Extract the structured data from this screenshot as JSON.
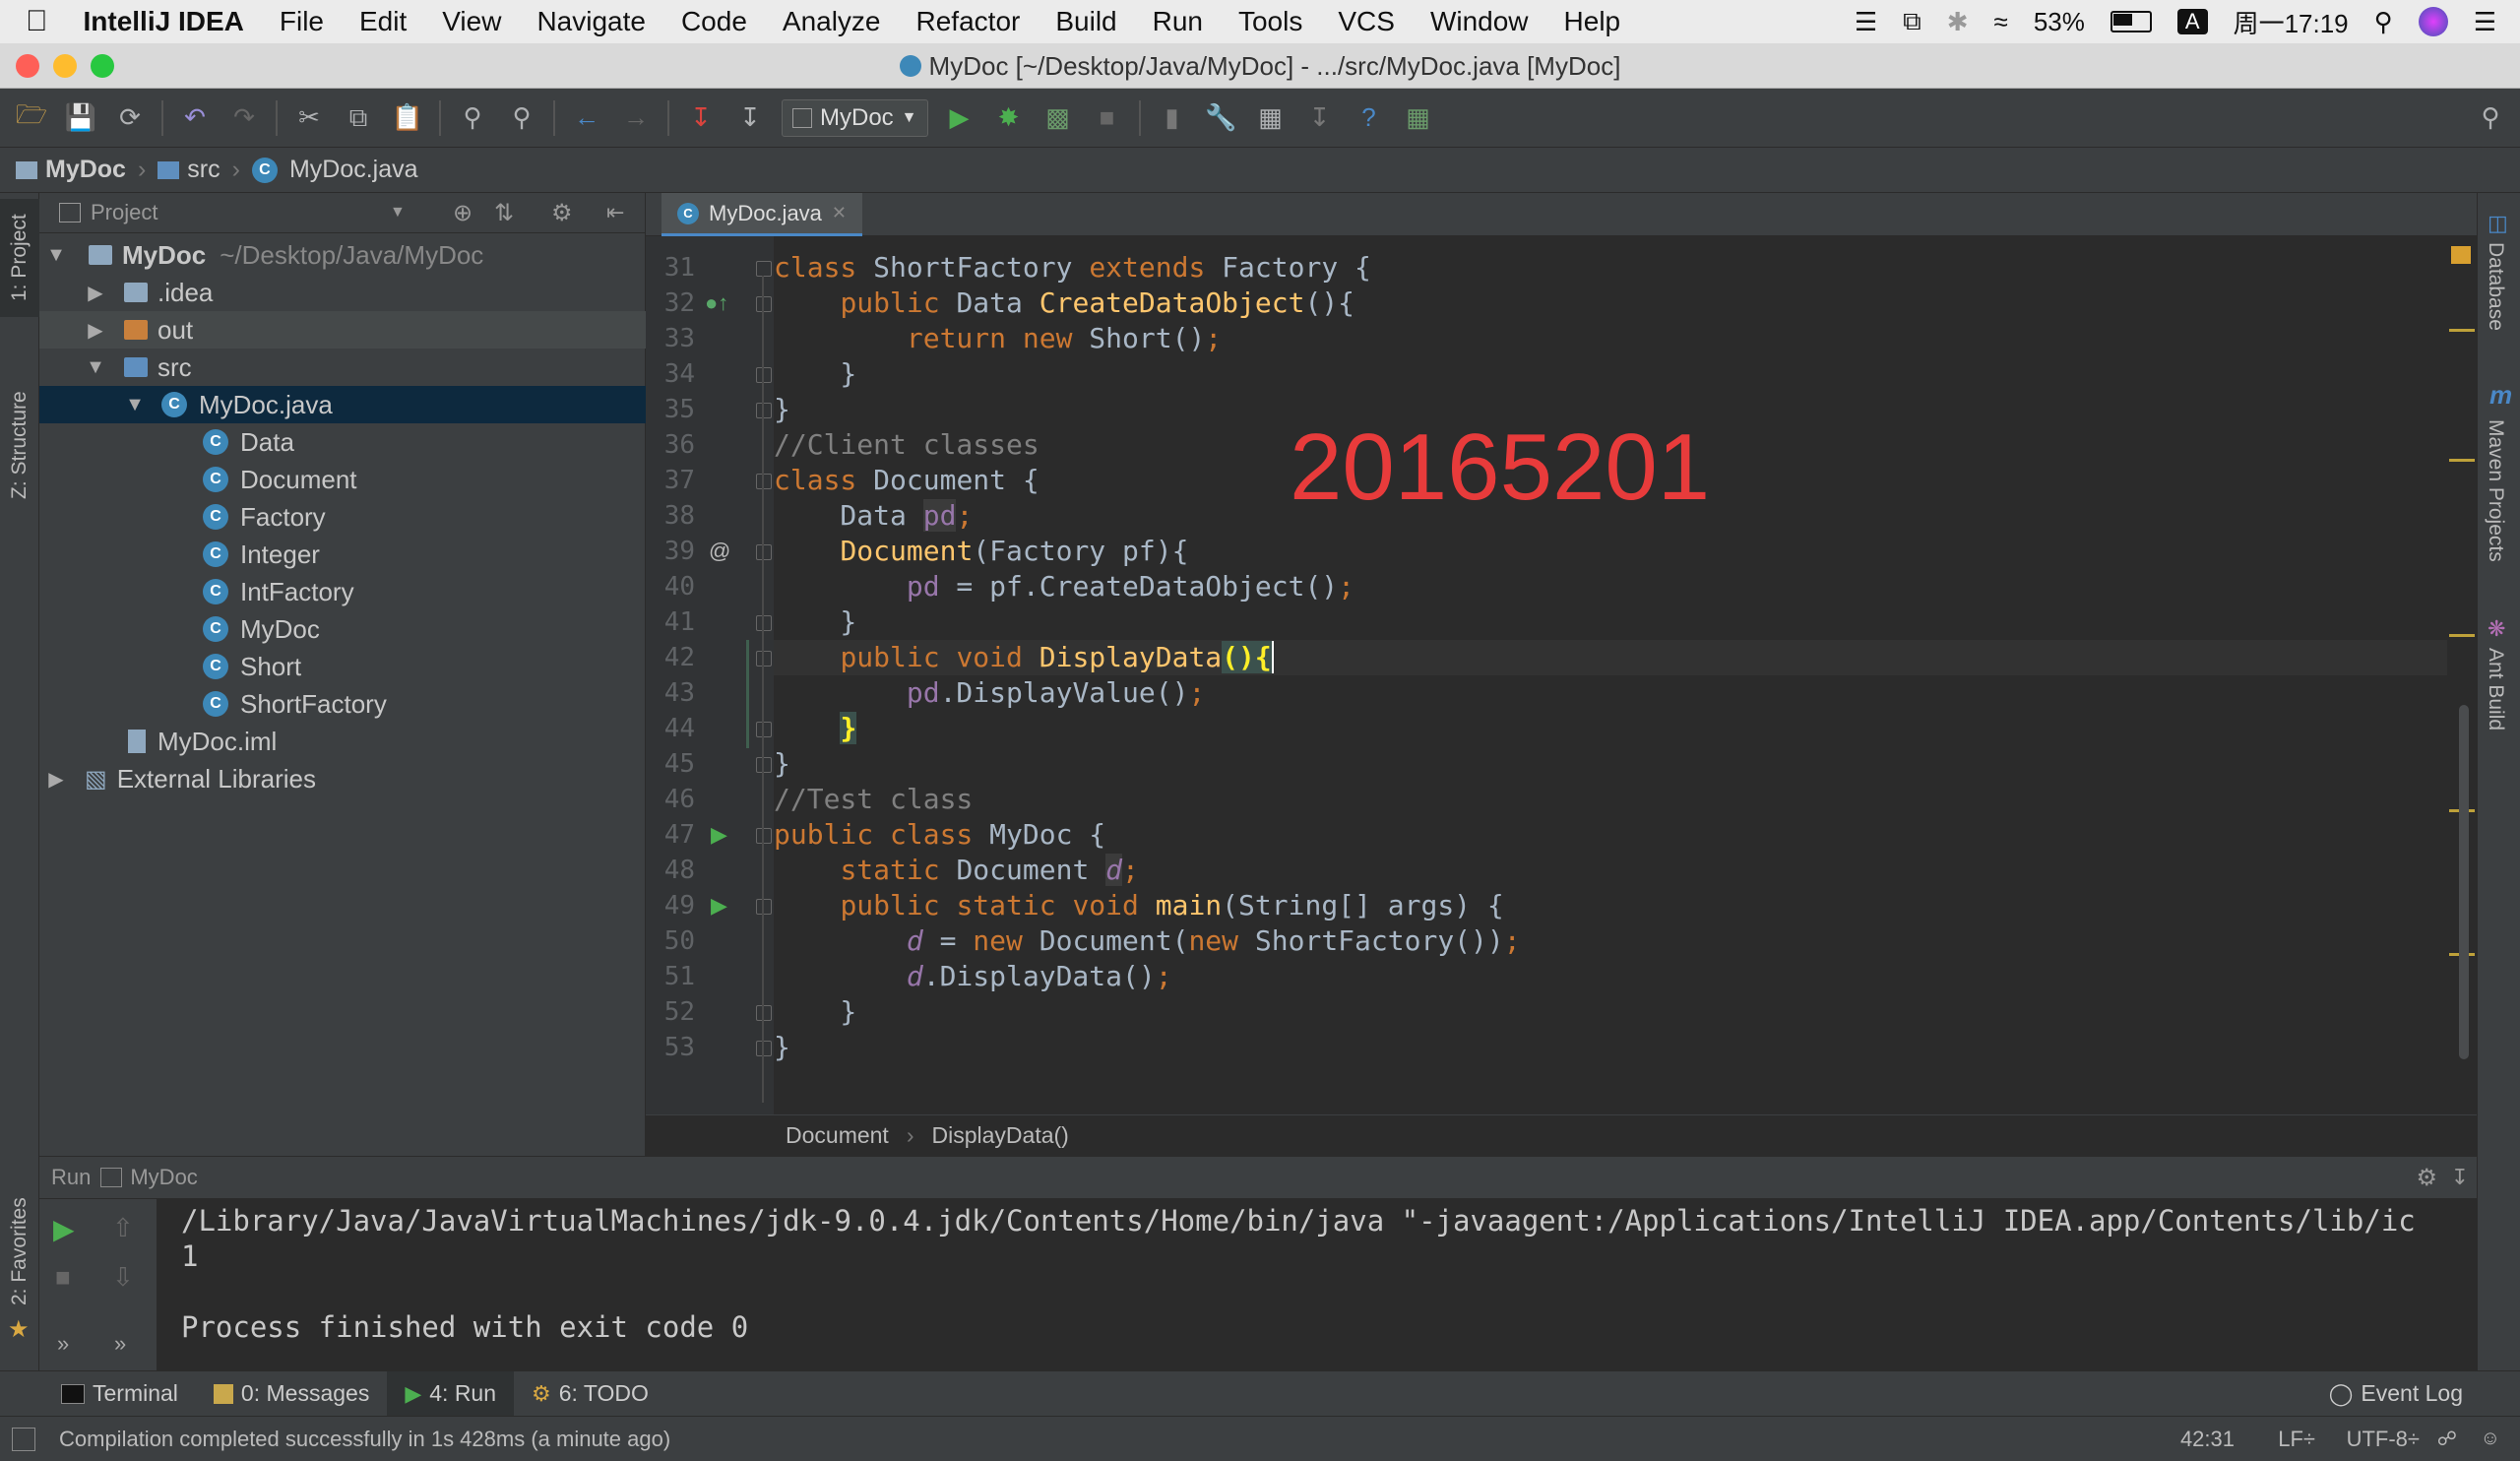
{
  "menubar": {
    "apple": "",
    "app": "IntelliJ IDEA",
    "items": [
      "File",
      "Edit",
      "View",
      "Navigate",
      "Code",
      "Analyze",
      "Refactor",
      "Build",
      "Run",
      "Tools",
      "VCS",
      "Window",
      "Help"
    ],
    "battery": "53%",
    "input": "A",
    "clock": "周一17:19"
  },
  "window": {
    "title": "MyDoc [~/Desktop/Java/MyDoc] - .../src/MyDoc.java [MyDoc]"
  },
  "toolbar": {
    "run_config": "MyDoc"
  },
  "navbar": {
    "crumbs": [
      "MyDoc",
      "src",
      "MyDoc.java"
    ]
  },
  "left_strip": {
    "project": "1: Project",
    "structure": "Z: Structure",
    "favorites": "2: Favorites"
  },
  "right_strip": {
    "database": "Database",
    "maven": "Maven Projects",
    "ant": "Ant Build"
  },
  "project": {
    "header": "Project",
    "root_name": "MyDoc",
    "root_path": "~/Desktop/Java/MyDoc",
    "nodes": {
      "idea": ".idea",
      "out": "out",
      "src": "src",
      "mydoc_java": "MyDoc.java",
      "classes": [
        "Data",
        "Document",
        "Factory",
        "Integer",
        "IntFactory",
        "MyDoc",
        "Short",
        "ShortFactory"
      ],
      "iml": "MyDoc.iml",
      "libs": "External Libraries"
    }
  },
  "editor": {
    "tab": "MyDoc.java",
    "line_numbers": [
      "31",
      "32",
      "33",
      "34",
      "35",
      "36",
      "37",
      "38",
      "39",
      "40",
      "41",
      "42",
      "43",
      "44",
      "45",
      "46",
      "47",
      "48",
      "49",
      "50",
      "51",
      "52",
      "53"
    ],
    "watermark": "20165201",
    "breadcrumb": [
      "Document",
      "DisplayData()"
    ]
  },
  "run": {
    "label": "Run",
    "config": "MyDoc",
    "lines": [
      "/Library/Java/JavaVirtualMachines/jdk-9.0.4.jdk/Contents/Home/bin/java \"-javaagent:/Applications/IntelliJ IDEA.app/Contents/lib/ic",
      "1",
      "",
      "Process finished with exit code 0"
    ]
  },
  "bottom_tabs": {
    "terminal": "Terminal",
    "messages": "0: Messages",
    "run": "4: Run",
    "todo": "6: TODO",
    "event_log": "Event Log"
  },
  "status": {
    "message": "Compilation completed successfully in 1s 428ms (a minute ago)",
    "position": "42:31",
    "line_sep": "LF÷",
    "encoding": "UTF-8÷"
  }
}
